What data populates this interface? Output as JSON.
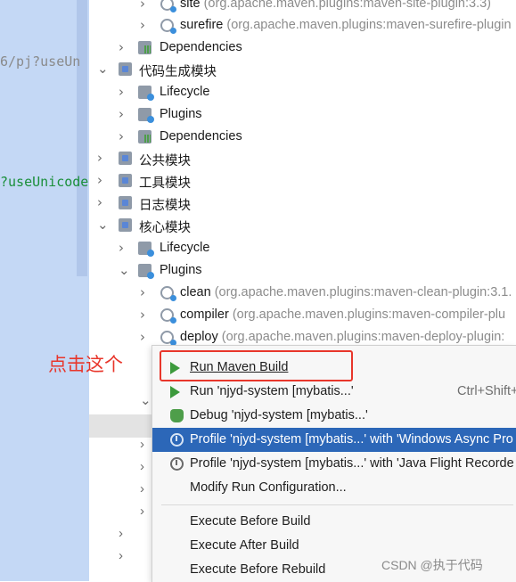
{
  "editor": {
    "code_line_1": "6/pj?useUn",
    "code_line_2": "?useUnicode"
  },
  "tree": [
    {
      "arrow": "›",
      "icon": "plugin-icon",
      "label": "site",
      "sub": " (org.apache.maven.plugins:maven-site-plugin:3.3)"
    },
    {
      "arrow": "›",
      "icon": "plugin-icon",
      "label": "surefire",
      "sub": " (org.apache.maven.plugins:maven-surefire-plugin"
    },
    {
      "arrow": "›",
      "icon": "dependencies-icon",
      "label": "Dependencies",
      "sub": ""
    },
    {
      "arrow": "⌄",
      "icon": "module-icon",
      "label": "代码生成模块",
      "sub": ""
    },
    {
      "arrow": "›",
      "icon": "folder-icon",
      "label": "Lifecycle",
      "sub": ""
    },
    {
      "arrow": "›",
      "icon": "folder-icon",
      "label": "Plugins",
      "sub": ""
    },
    {
      "arrow": "›",
      "icon": "dependencies-icon",
      "label": "Dependencies",
      "sub": ""
    },
    {
      "arrow": "›",
      "icon": "module-icon",
      "label": "公共模块",
      "sub": ""
    },
    {
      "arrow": "›",
      "icon": "module-icon",
      "label": "工具模块",
      "sub": ""
    },
    {
      "arrow": "›",
      "icon": "module-icon",
      "label": "日志模块",
      "sub": ""
    },
    {
      "arrow": "⌄",
      "icon": "module-icon",
      "label": "核心模块",
      "sub": ""
    },
    {
      "arrow": "›",
      "icon": "folder-icon",
      "label": "Lifecycle",
      "sub": ""
    },
    {
      "arrow": "⌄",
      "icon": "folder-icon",
      "label": "Plugins",
      "sub": ""
    },
    {
      "arrow": "›",
      "icon": "plugin-icon",
      "label": "clean",
      "sub": " (org.apache.maven.plugins:maven-clean-plugin:3.1."
    },
    {
      "arrow": "›",
      "icon": "plugin-icon",
      "label": "compiler",
      "sub": " (org.apache.maven.plugins:maven-compiler-plu"
    },
    {
      "arrow": "›",
      "icon": "plugin-icon",
      "label": "deploy",
      "sub": " (org.apache.maven.plugins:maven-deploy-plugin:"
    }
  ],
  "annotation": "点击这个",
  "menu": {
    "items": [
      {
        "icon": "run-icon",
        "label": "Run Maven Build",
        "shortcut": ""
      },
      {
        "icon": "run-icon",
        "label": "Run 'njyd-system [mybatis...'",
        "shortcut": "Ctrl+Shift+"
      },
      {
        "icon": "debug-icon",
        "label": "Debug 'njyd-system [mybatis...'",
        "shortcut": ""
      },
      {
        "icon": "profile-icon",
        "label": "Profile 'njyd-system [mybatis...' with 'Windows Async Pro",
        "shortcut": ""
      },
      {
        "icon": "profile-icon",
        "label": "Profile 'njyd-system [mybatis...' with 'Java Flight Recorde",
        "shortcut": ""
      },
      {
        "icon": "",
        "label": "Modify Run Configuration...",
        "shortcut": ""
      },
      {
        "icon": "",
        "label": "Execute Before Build",
        "shortcut": ""
      },
      {
        "icon": "",
        "label": "Execute After Build",
        "shortcut": ""
      },
      {
        "icon": "",
        "label": "Execute Before Rebuild",
        "shortcut": ""
      }
    ]
  },
  "watermark": "CSDN @执于代码",
  "colors": {
    "selection": "#2c67b8",
    "annotation": "#e8362b",
    "run_green": "#3c9a3c"
  }
}
